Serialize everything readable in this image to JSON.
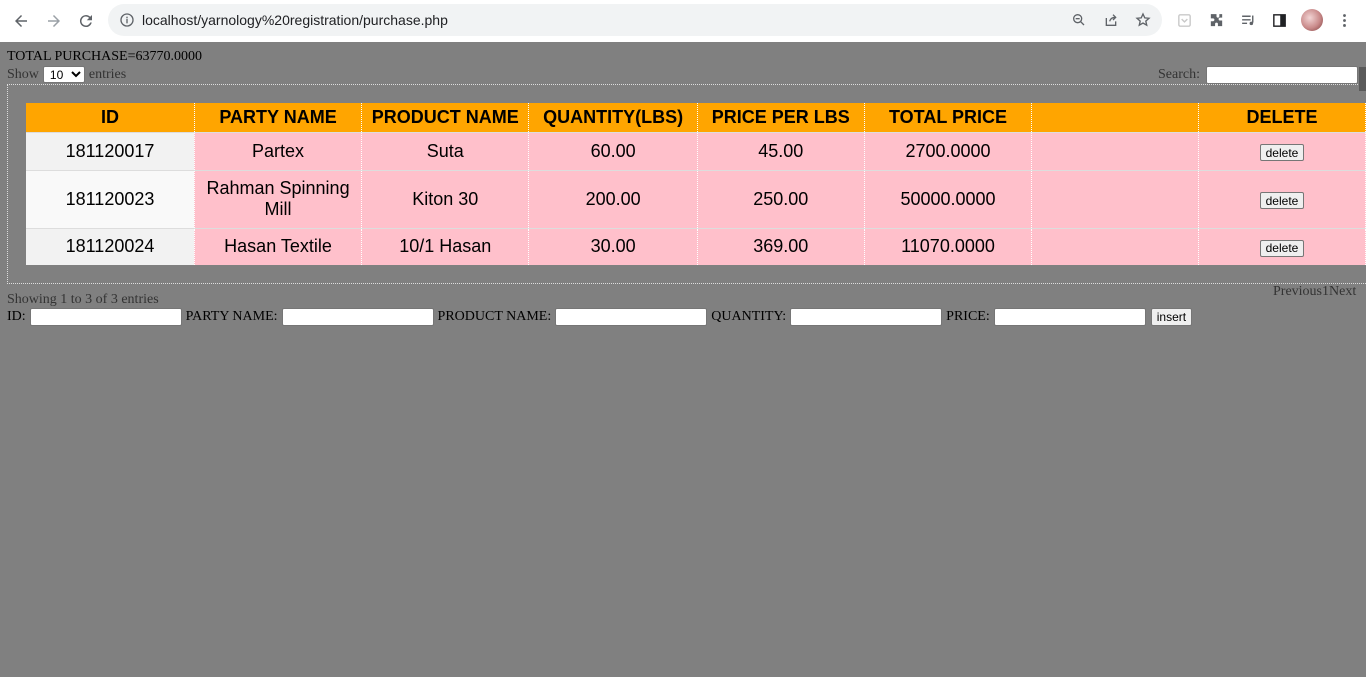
{
  "browser": {
    "url": "localhost/yarnology%20registration/purchase.php"
  },
  "summary": {
    "total_purchase": "TOTAL PURCHASE=63770.0000"
  },
  "length_control": {
    "show_label": "Show",
    "selected": "10",
    "entries_label": "entries"
  },
  "search": {
    "label": "Search:",
    "value": ""
  },
  "table": {
    "headers": [
      "ID",
      "PARTY NAME",
      "PRODUCT NAME",
      "QUANTITY(LBS)",
      "PRICE PER LBS",
      "TOTAL PRICE",
      "",
      "DELETE"
    ],
    "rows": [
      {
        "id": "181120017",
        "party": "Partex",
        "product": "Suta",
        "quantity": "60.00",
        "price": "45.00",
        "total": "2700.0000",
        "extra": "",
        "delete_label": "delete"
      },
      {
        "id": "181120023",
        "party": "Rahman Spinning Mill",
        "product": "Kiton 30",
        "quantity": "200.00",
        "price": "250.00",
        "total": "50000.0000",
        "extra": "",
        "delete_label": "delete"
      },
      {
        "id": "181120024",
        "party": "Hasan Textile",
        "product": "10/1 Hasan",
        "quantity": "30.00",
        "price": "369.00",
        "total": "11070.0000",
        "extra": "",
        "delete_label": "delete"
      }
    ]
  },
  "info": "Showing 1 to 3 of 3 entries",
  "pagination": {
    "previous": "Previous",
    "page": "1",
    "next": "Next"
  },
  "form": {
    "id_label": "ID:",
    "party_label": "PARTY NAME:",
    "product_label": "PRODUCT NAME:",
    "quantity_label": "QUANTITY:",
    "price_label": "PRICE:",
    "insert_label": "insert"
  }
}
